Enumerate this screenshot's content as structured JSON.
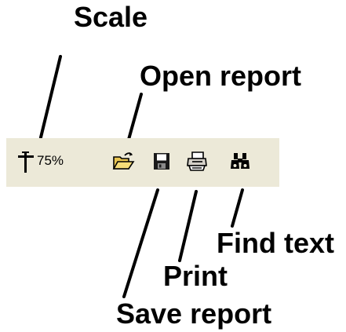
{
  "callouts": {
    "scale": "Scale",
    "open_report": "Open report",
    "find_text": "Find text",
    "print": "Print",
    "save_report": "Save report"
  },
  "toolbar": {
    "zoom_value": "75%",
    "background": "#ece9d8",
    "icons": {
      "scale": "scale-icon",
      "open_report": "folder-open-icon",
      "save_report": "floppy-disk-icon",
      "print": "printer-icon",
      "find_text": "binoculars-icon"
    }
  }
}
